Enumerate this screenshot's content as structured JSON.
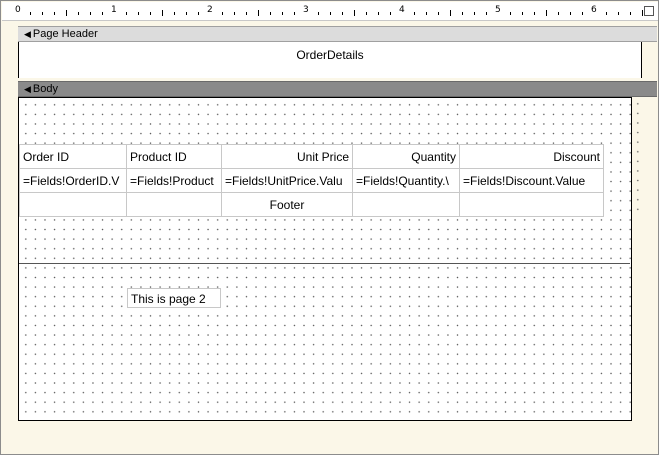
{
  "ruler": {
    "numbers": [
      "0",
      "1",
      "2",
      "3",
      "4",
      "5",
      "6"
    ]
  },
  "bands": {
    "page_header": "Page Header",
    "body": "Body"
  },
  "page_header": {
    "title": "OrderDetails"
  },
  "table": {
    "headers": [
      "Order ID",
      "Product ID",
      "Unit Price",
      "Quantity",
      "Discount"
    ],
    "detail": [
      "=Fields!OrderID.V",
      "=Fields!Product",
      "=Fields!UnitPrice.Valu",
      "=Fields!Quantity.\\",
      "=Fields!Discount.Value"
    ],
    "footer_label": "Footer"
  },
  "textbox": {
    "text": "This is page 2"
  }
}
